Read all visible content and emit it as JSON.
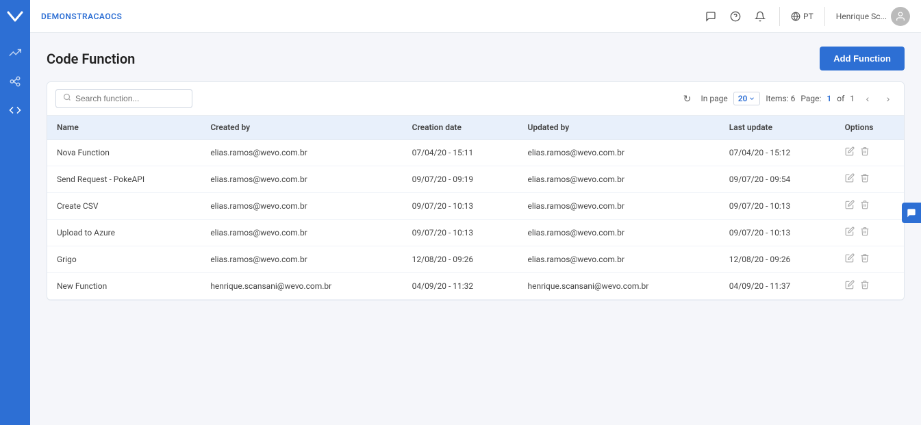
{
  "sidebar": {
    "brand": "W",
    "nav_items": [
      {
        "id": "analytics",
        "icon": "↗",
        "label": "analytics-icon"
      },
      {
        "id": "flows",
        "icon": "⇌",
        "label": "flows-icon"
      },
      {
        "id": "code",
        "icon": "</>",
        "label": "code-icon"
      }
    ]
  },
  "header": {
    "title": "DEMONSTRACAOCS",
    "icons": {
      "chat": "💬",
      "help": "?",
      "bell": "🔔",
      "globe": "🌐",
      "lang": "PT"
    },
    "user": {
      "name": "Henrique Sc...",
      "avatar": "👤"
    }
  },
  "page": {
    "title": "Code Function",
    "add_button_label": "Add Function"
  },
  "toolbar": {
    "search_placeholder": "Search function...",
    "refresh_label": "↻",
    "in_page_label": "In page",
    "per_page": "20",
    "items_label": "Items: 6",
    "page_label": "Page:",
    "current_page": "1",
    "total_pages": "1",
    "prev_label": "‹",
    "next_label": "›"
  },
  "table": {
    "columns": [
      "Name",
      "Created by",
      "Creation date",
      "Updated by",
      "Last update",
      "Options"
    ],
    "rows": [
      {
        "name": "Nova Function",
        "created_by": "elias.ramos@wevo.com.br",
        "creation_date": "07/04/20 - 15:11",
        "updated_by": "elias.ramos@wevo.com.br",
        "last_update": "07/04/20 - 15:12"
      },
      {
        "name": "Send Request - PokeAPI",
        "created_by": "elias.ramos@wevo.com.br",
        "creation_date": "09/07/20 - 09:19",
        "updated_by": "elias.ramos@wevo.com.br",
        "last_update": "09/07/20 - 09:54"
      },
      {
        "name": "Create CSV",
        "created_by": "elias.ramos@wevo.com.br",
        "creation_date": "09/07/20 - 10:13",
        "updated_by": "elias.ramos@wevo.com.br",
        "last_update": "09/07/20 - 10:13"
      },
      {
        "name": "Upload to Azure",
        "created_by": "elias.ramos@wevo.com.br",
        "creation_date": "09/07/20 - 10:13",
        "updated_by": "elias.ramos@wevo.com.br",
        "last_update": "09/07/20 - 10:13"
      },
      {
        "name": "Grigo",
        "created_by": "elias.ramos@wevo.com.br",
        "creation_date": "12/08/20 - 09:26",
        "updated_by": "elias.ramos@wevo.com.br",
        "last_update": "12/08/20 - 09:26"
      },
      {
        "name": "New Function",
        "created_by": "henrique.scansani@wevo.com.br",
        "creation_date": "04/09/20 - 11:32",
        "updated_by": "henrique.scansani@wevo.com.br",
        "last_update": "04/09/20 - 11:37"
      }
    ]
  },
  "widget": {
    "icon": "💬"
  }
}
